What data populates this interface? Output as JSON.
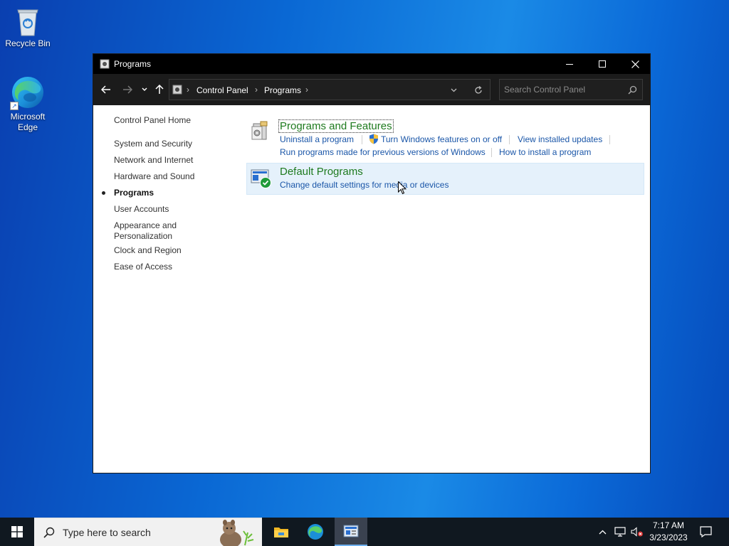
{
  "desktop": {
    "icons": [
      {
        "label": "Recycle Bin"
      },
      {
        "label": "Microsoft Edge"
      }
    ]
  },
  "window": {
    "title": "Programs",
    "minimize_icon": "minimize-icon",
    "maximize_icon": "maximize-icon",
    "close_icon": "close-icon"
  },
  "address": {
    "crumbs": [
      "Control Panel",
      "Programs"
    ]
  },
  "search": {
    "placeholder": "Search Control Panel"
  },
  "leftnav": {
    "home": "Control Panel Home",
    "items": [
      {
        "label": "System and Security"
      },
      {
        "label": "Network and Internet"
      },
      {
        "label": "Hardware and Sound"
      },
      {
        "label": "Programs",
        "current": true
      },
      {
        "label": "User Accounts"
      },
      {
        "label": "Appearance and Personalization"
      },
      {
        "label": "Clock and Region"
      },
      {
        "label": "Ease of Access"
      }
    ]
  },
  "categories": {
    "programs_features": {
      "title": "Programs and Features",
      "links": [
        "Uninstall a program",
        "Turn Windows features on or off",
        "View installed updates",
        "Run programs made for previous versions of Windows",
        "How to install a program"
      ]
    },
    "default_programs": {
      "title": "Default Programs",
      "links": [
        "Change default settings for media or devices"
      ]
    }
  },
  "taskbar": {
    "search_placeholder": "Type here to search",
    "time": "7:17 AM",
    "date": "3/23/2023"
  },
  "colors": {
    "title_green": "#1e7a1e",
    "link_blue": "#1a56a8",
    "highlight": "#e5f1fb"
  }
}
